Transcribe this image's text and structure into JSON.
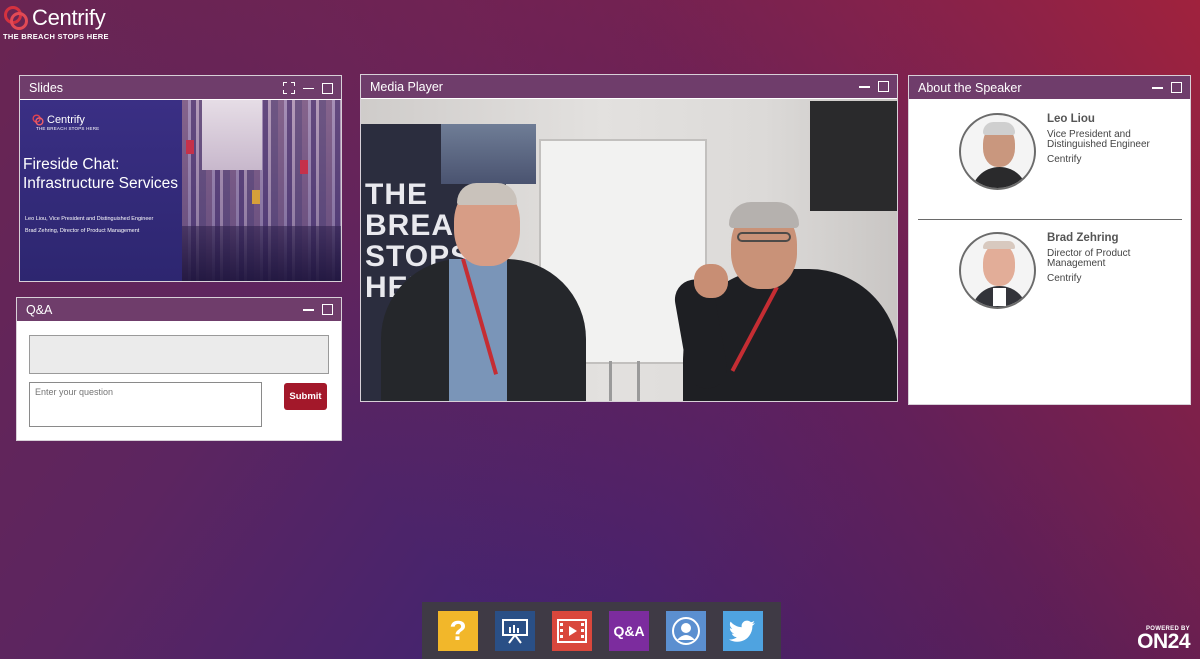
{
  "brand": {
    "name": "Centrify",
    "tagline": "THE BREACH STOPS HERE",
    "accent": "#a3182a",
    "panel_header_color": "#6f3d6b"
  },
  "slides_panel": {
    "title": "Slides",
    "slide": {
      "logo_text": "Centrify",
      "logo_tag": "THE BREACH STOPS HERE",
      "heading_line1": "Fireside Chat:",
      "heading_line2": "Infrastructure Services",
      "presenter1": "Leo Liou, Vice President and Distinguished Engineer",
      "presenter2": "Brad Zehring, Director of Product Management"
    }
  },
  "qa_panel": {
    "title": "Q&A",
    "input_placeholder": "Enter your question",
    "submit_label": "Submit"
  },
  "media_panel": {
    "title": "Media Player",
    "banner_text": "THE\nBREACH\nSTOPS\nHERE"
  },
  "about_panel": {
    "title": "About the Speaker",
    "speakers": [
      {
        "name": "Leo Liou",
        "title": "Vice President and Distinguished Engineer",
        "company": "Centrify"
      },
      {
        "name": "Brad Zehring",
        "title": "Director of Product Management",
        "company": "Centrify"
      }
    ]
  },
  "toolbar": {
    "items": [
      {
        "icon": "help-icon",
        "label": "?"
      },
      {
        "icon": "slides-icon"
      },
      {
        "icon": "media-player-icon"
      },
      {
        "icon": "qa-icon",
        "label": "Q&A"
      },
      {
        "icon": "speaker-icon"
      },
      {
        "icon": "twitter-icon"
      }
    ]
  },
  "footer": {
    "powered_by": "POWERED BY",
    "logo": "ON24"
  }
}
